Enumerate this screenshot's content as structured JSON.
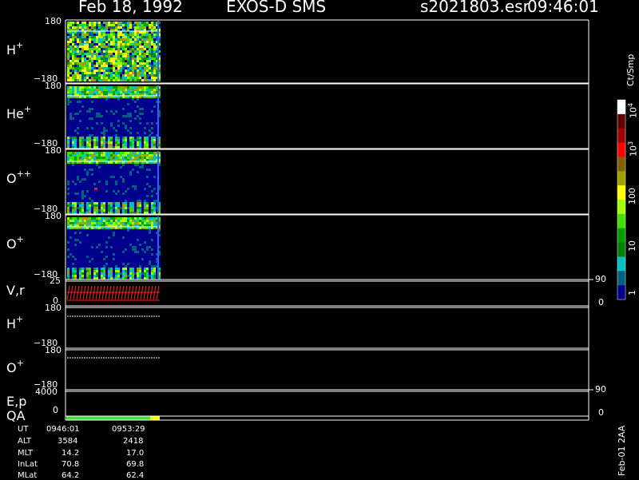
{
  "header": {
    "date": "Feb 18, 1992",
    "mission": "EXOS-D SMS",
    "file": "s2021803.esr",
    "time": "09:46:01"
  },
  "colorbar": {
    "unit": "Ct/Smp",
    "labels": [
      "10^4",
      "10^3",
      "100",
      "10",
      "1"
    ],
    "colors": [
      "#ffffff",
      "#600000",
      "#a00000",
      "#ff0000",
      "#806000",
      "#a0a000",
      "#ffff00",
      "#a0ff00",
      "#40e000",
      "#00a000",
      "#008000",
      "#00c0c0",
      "#006080",
      "#00008c"
    ]
  },
  "panels": [
    {
      "label": "H",
      "sup": "+",
      "top": "180",
      "bottom": "−180"
    },
    {
      "label": "He",
      "sup": "+",
      "top": "180",
      "bottom": "−180"
    },
    {
      "label": "O",
      "sup": "++",
      "top": "180",
      "bottom": "−180"
    },
    {
      "label": "O",
      "sup": "+",
      "top": "180",
      "bottom": "−180"
    },
    {
      "label": "V,r",
      "sup": "",
      "top": "25",
      "bottom": "0",
      "right_top": "90",
      "right_bottom": "0"
    },
    {
      "label": "H",
      "sup": "+",
      "top": "180",
      "bottom": "−180"
    },
    {
      "label": "O",
      "sup": "+",
      "top": "180",
      "bottom": "−180"
    },
    {
      "label": "E,p",
      "sup": "",
      "top": "4000",
      "bottom": "0",
      "right_top": "90",
      "right_bottom": "0"
    },
    {
      "label": "QA",
      "sup": "",
      "top": "",
      "bottom": ""
    }
  ],
  "info": {
    "rows": [
      {
        "name": "UT",
        "v1": "0946:01",
        "v2": "0953:29"
      },
      {
        "name": "ALT",
        "v1": "3584",
        "v2": "2418"
      },
      {
        "name": "MLT",
        "v1": "14.2",
        "v2": "17.0"
      },
      {
        "name": "InLat",
        "v1": "70.8",
        "v2": "69.8"
      },
      {
        "name": "MLat",
        "v1": "64.2",
        "v2": "62.4"
      }
    ]
  },
  "version": "Feb-01 2AA"
}
